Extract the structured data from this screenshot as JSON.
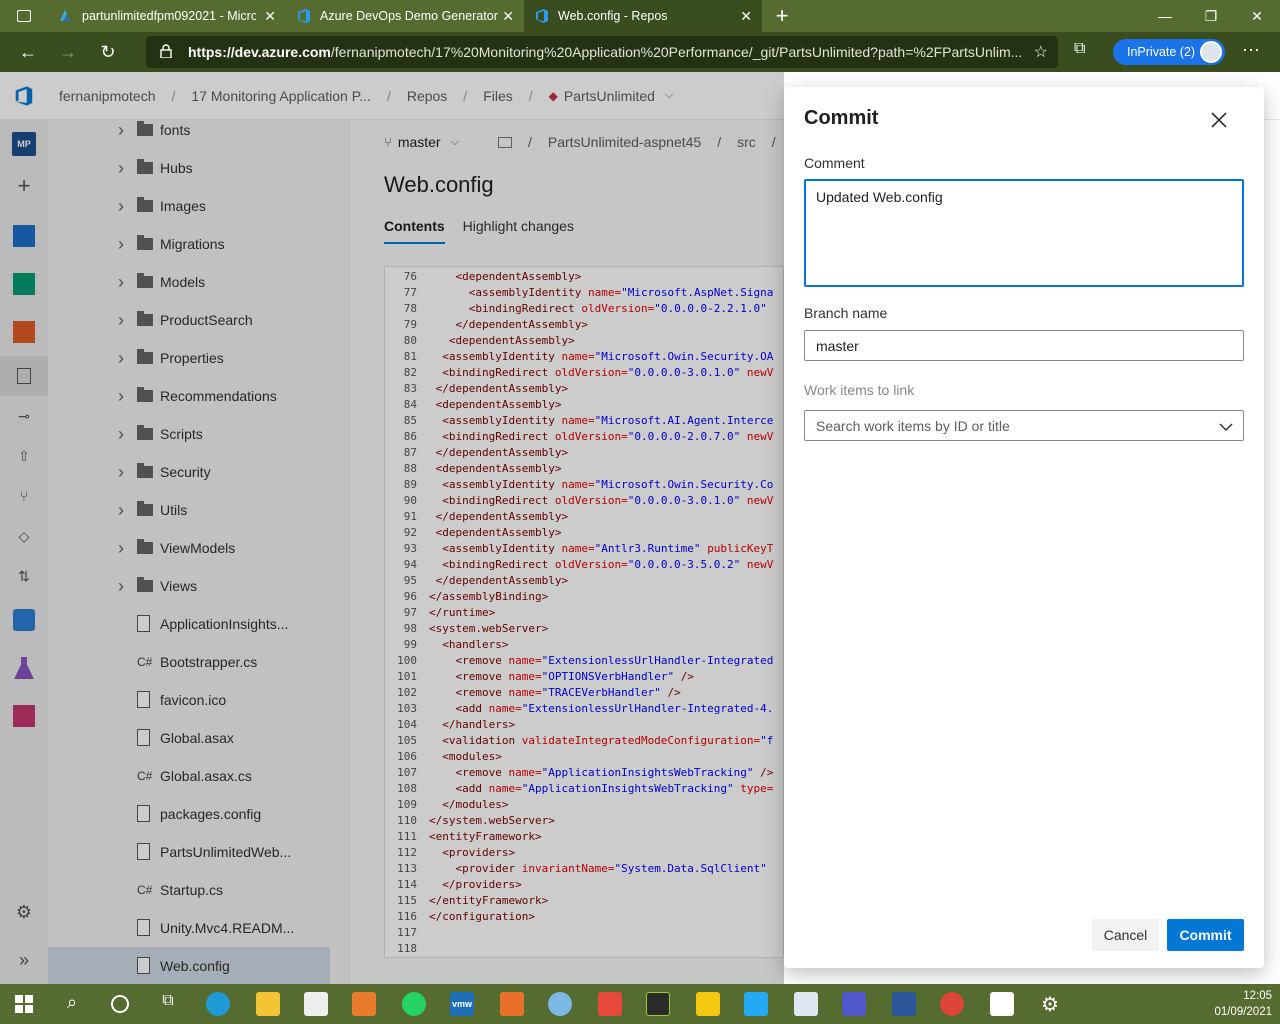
{
  "browser": {
    "tabs": [
      {
        "title": "partunlimitedfpm092021 - Micro",
        "active": false
      },
      {
        "title": "Azure DevOps Demo Generator",
        "active": false
      },
      {
        "title": "Web.config - Repos",
        "active": true
      }
    ],
    "url_host": "https://dev.azure.com",
    "url_path": "/fernanipmotech/17%20Monitoring%20Application%20Performance/_git/PartsUnlimited?path=%2FPartsUnlim...",
    "inprivate_label": "InPrivate (2)"
  },
  "header": {
    "breadcrumbs": [
      "fernanipmotech",
      "17 Monitoring Application P...",
      "Repos",
      "Files",
      "PartsUnlimited"
    ]
  },
  "rail": {
    "project_badge": "MP"
  },
  "tree": {
    "items": [
      {
        "label": "fonts",
        "kind": "folder"
      },
      {
        "label": "Hubs",
        "kind": "folder"
      },
      {
        "label": "Images",
        "kind": "folder"
      },
      {
        "label": "Migrations",
        "kind": "folder"
      },
      {
        "label": "Models",
        "kind": "folder"
      },
      {
        "label": "ProductSearch",
        "kind": "folder"
      },
      {
        "label": "Properties",
        "kind": "folder"
      },
      {
        "label": "Recommendations",
        "kind": "folder"
      },
      {
        "label": "Scripts",
        "kind": "folder"
      },
      {
        "label": "Security",
        "kind": "folder"
      },
      {
        "label": "Utils",
        "kind": "folder"
      },
      {
        "label": "ViewModels",
        "kind": "folder"
      },
      {
        "label": "Views",
        "kind": "folder"
      },
      {
        "label": "ApplicationInsights...",
        "kind": "file"
      },
      {
        "label": "Bootstrapper.cs",
        "kind": "cs"
      },
      {
        "label": "favicon.ico",
        "kind": "file"
      },
      {
        "label": "Global.asax",
        "kind": "file"
      },
      {
        "label": "Global.asax.cs",
        "kind": "cs"
      },
      {
        "label": "packages.config",
        "kind": "file"
      },
      {
        "label": "PartsUnlimitedWeb...",
        "kind": "file"
      },
      {
        "label": "Startup.cs",
        "kind": "cs"
      },
      {
        "label": "Unity.Mvc4.READM...",
        "kind": "file"
      },
      {
        "label": "Web.config",
        "kind": "file",
        "selected": true
      }
    ],
    "cs_badge": "C#"
  },
  "main": {
    "branch": "master",
    "path": [
      "PartsUnlimited-aspnet45",
      "src"
    ],
    "file_title": "Web.config",
    "tabs": [
      "Contents",
      "Highlight changes"
    ],
    "code_lines": [
      {
        "n": "76",
        "segs": [
          [
            "    ",
            ""
          ],
          [
            "<dependentAssembly>",
            "tg"
          ]
        ]
      },
      {
        "n": "77",
        "segs": [
          [
            "      ",
            ""
          ],
          [
            "<assemblyIdentity ",
            "tg"
          ],
          [
            "name=",
            "an"
          ],
          [
            "\"Microsoft.AspNet.Signa",
            "av"
          ]
        ]
      },
      {
        "n": "78",
        "segs": [
          [
            "      ",
            ""
          ],
          [
            "<bindingRedirect ",
            "tg"
          ],
          [
            "oldVersion=",
            "an"
          ],
          [
            "\"0.0.0.0-2.2.1.0\"",
            "av"
          ]
        ]
      },
      {
        "n": "79",
        "segs": [
          [
            "    ",
            ""
          ],
          [
            "</dependentAssembly>",
            "tg"
          ]
        ]
      },
      {
        "n": "80",
        "segs": [
          [
            "   ",
            ""
          ],
          [
            "<dependentAssembly>",
            "tg"
          ]
        ]
      },
      {
        "n": "81",
        "segs": [
          [
            "  ",
            ""
          ],
          [
            "<assemblyIdentity ",
            "tg"
          ],
          [
            "name=",
            "an"
          ],
          [
            "\"Microsoft.Owin.Security.OA",
            "av"
          ]
        ]
      },
      {
        "n": "82",
        "segs": [
          [
            "  ",
            ""
          ],
          [
            "<bindingRedirect ",
            "tg"
          ],
          [
            "oldVersion=",
            "an"
          ],
          [
            "\"0.0.0.0-3.0.1.0\" ",
            "av"
          ],
          [
            "newV",
            "an"
          ]
        ]
      },
      {
        "n": "83",
        "segs": [
          [
            " ",
            ""
          ],
          [
            "</dependentAssembly>",
            "tg"
          ]
        ]
      },
      {
        "n": "84",
        "segs": [
          [
            " ",
            ""
          ],
          [
            "<dependentAssembly>",
            "tg"
          ]
        ]
      },
      {
        "n": "85",
        "segs": [
          [
            "  ",
            ""
          ],
          [
            "<assemblyIdentity ",
            "tg"
          ],
          [
            "name=",
            "an"
          ],
          [
            "\"Microsoft.AI.Agent.Interce",
            "av"
          ]
        ]
      },
      {
        "n": "86",
        "segs": [
          [
            "  ",
            ""
          ],
          [
            "<bindingRedirect ",
            "tg"
          ],
          [
            "oldVersion=",
            "an"
          ],
          [
            "\"0.0.0.0-2.0.7.0\" ",
            "av"
          ],
          [
            "newV",
            "an"
          ]
        ]
      },
      {
        "n": "87",
        "segs": [
          [
            " ",
            ""
          ],
          [
            "</dependentAssembly>",
            "tg"
          ]
        ]
      },
      {
        "n": "88",
        "segs": [
          [
            " ",
            ""
          ],
          [
            "<dependentAssembly>",
            "tg"
          ]
        ]
      },
      {
        "n": "89",
        "segs": [
          [
            "  ",
            ""
          ],
          [
            "<assemblyIdentity ",
            "tg"
          ],
          [
            "name=",
            "an"
          ],
          [
            "\"Microsoft.Owin.Security.Co",
            "av"
          ]
        ]
      },
      {
        "n": "90",
        "segs": [
          [
            "  ",
            ""
          ],
          [
            "<bindingRedirect ",
            "tg"
          ],
          [
            "oldVersion=",
            "an"
          ],
          [
            "\"0.0.0.0-3.0.1.0\" ",
            "av"
          ],
          [
            "newV",
            "an"
          ]
        ]
      },
      {
        "n": "91",
        "segs": [
          [
            " ",
            ""
          ],
          [
            "</dependentAssembly>",
            "tg"
          ]
        ]
      },
      {
        "n": "92",
        "segs": [
          [
            " ",
            ""
          ],
          [
            "<dependentAssembly>",
            "tg"
          ]
        ]
      },
      {
        "n": "93",
        "segs": [
          [
            "  ",
            ""
          ],
          [
            "<assemblyIdentity ",
            "tg"
          ],
          [
            "name=",
            "an"
          ],
          [
            "\"Antlr3.Runtime\" ",
            "av"
          ],
          [
            "publicKeyT",
            "an"
          ]
        ]
      },
      {
        "n": "94",
        "segs": [
          [
            "  ",
            ""
          ],
          [
            "<bindingRedirect ",
            "tg"
          ],
          [
            "oldVersion=",
            "an"
          ],
          [
            "\"0.0.0.0-3.5.0.2\" ",
            "av"
          ],
          [
            "newV",
            "an"
          ]
        ]
      },
      {
        "n": "95",
        "segs": [
          [
            " ",
            ""
          ],
          [
            "</dependentAssembly>",
            "tg"
          ]
        ]
      },
      {
        "n": "96",
        "segs": [
          [
            "",
            ""
          ],
          [
            "</assemblyBinding>",
            "tg"
          ]
        ]
      },
      {
        "n": "97",
        "segs": [
          [
            "",
            ""
          ],
          [
            "</runtime>",
            "tg"
          ]
        ]
      },
      {
        "n": "98",
        "segs": [
          [
            "",
            ""
          ],
          [
            "<system.webServer>",
            "tg"
          ]
        ]
      },
      {
        "n": "99",
        "segs": [
          [
            "  ",
            ""
          ],
          [
            "<handlers>",
            "tg"
          ]
        ]
      },
      {
        "n": "100",
        "segs": [
          [
            "    ",
            ""
          ],
          [
            "<remove ",
            "tg"
          ],
          [
            "name=",
            "an"
          ],
          [
            "\"ExtensionlessUrlHandler-Integrated",
            "av"
          ]
        ]
      },
      {
        "n": "101",
        "segs": [
          [
            "    ",
            ""
          ],
          [
            "<remove ",
            "tg"
          ],
          [
            "name=",
            "an"
          ],
          [
            "\"OPTIONSVerbHandler\" ",
            "av"
          ],
          [
            "/>",
            "tg"
          ]
        ]
      },
      {
        "n": "102",
        "segs": [
          [
            "    ",
            ""
          ],
          [
            "<remove ",
            "tg"
          ],
          [
            "name=",
            "an"
          ],
          [
            "\"TRACEVerbHandler\" ",
            "av"
          ],
          [
            "/>",
            "tg"
          ]
        ]
      },
      {
        "n": "103",
        "segs": [
          [
            "    ",
            ""
          ],
          [
            "<add ",
            "tg"
          ],
          [
            "name=",
            "an"
          ],
          [
            "\"ExtensionlessUrlHandler-Integrated-4.",
            "av"
          ]
        ]
      },
      {
        "n": "104",
        "segs": [
          [
            "  ",
            ""
          ],
          [
            "</handlers>",
            "tg"
          ]
        ]
      },
      {
        "n": "105",
        "segs": [
          [
            "  ",
            ""
          ],
          [
            "<validation ",
            "tg"
          ],
          [
            "validateIntegratedModeConfiguration=",
            "an"
          ],
          [
            "\"f",
            "av"
          ]
        ]
      },
      {
        "n": "106",
        "segs": [
          [
            "  ",
            ""
          ],
          [
            "<modules>",
            "tg"
          ]
        ]
      },
      {
        "n": "107",
        "segs": [
          [
            "    ",
            ""
          ],
          [
            "<remove ",
            "tg"
          ],
          [
            "name=",
            "an"
          ],
          [
            "\"ApplicationInsightsWebTracking\" ",
            "av"
          ],
          [
            "/>",
            "tg"
          ]
        ]
      },
      {
        "n": "108",
        "segs": [
          [
            "    ",
            ""
          ],
          [
            "<add ",
            "tg"
          ],
          [
            "name=",
            "an"
          ],
          [
            "\"ApplicationInsightsWebTracking\" ",
            "av"
          ],
          [
            "type=",
            "an"
          ]
        ]
      },
      {
        "n": "109",
        "segs": [
          [
            "  ",
            ""
          ],
          [
            "</modules>",
            "tg"
          ]
        ]
      },
      {
        "n": "110",
        "segs": [
          [
            "",
            ""
          ],
          [
            "</system.webServer>",
            "tg"
          ]
        ]
      },
      {
        "n": "111",
        "segs": [
          [
            "",
            ""
          ],
          [
            "<entityFramework>",
            "tg"
          ]
        ]
      },
      {
        "n": "112",
        "segs": [
          [
            "  ",
            ""
          ],
          [
            "<providers>",
            "tg"
          ]
        ]
      },
      {
        "n": "113",
        "segs": [
          [
            "    ",
            ""
          ],
          [
            "<provider ",
            "tg"
          ],
          [
            "invariantName=",
            "an"
          ],
          [
            "\"System.Data.SqlClient\"",
            "av"
          ]
        ]
      },
      {
        "n": "114",
        "segs": [
          [
            "  ",
            ""
          ],
          [
            "</providers>",
            "tg"
          ]
        ]
      },
      {
        "n": "115",
        "segs": [
          [
            "",
            ""
          ],
          [
            "</entityFramework>",
            "tg"
          ]
        ]
      },
      {
        "n": "116",
        "segs": [
          [
            "",
            ""
          ],
          [
            "</configuration>",
            "tg"
          ]
        ]
      },
      {
        "n": "117",
        "segs": [
          [
            "",
            ""
          ]
        ]
      },
      {
        "n": "118",
        "segs": [
          [
            "",
            ""
          ]
        ]
      }
    ]
  },
  "commit_panel": {
    "title": "Commit",
    "comment_label": "Comment",
    "comment_value": "Updated Web.config",
    "branch_label": "Branch name",
    "branch_value": "master",
    "work_items_label": "Work items to link",
    "work_items_placeholder": "Search work items by ID or title",
    "cancel_label": "Cancel",
    "commit_label": "Commit"
  },
  "taskbar": {
    "time": "12:05",
    "date": "01/09/2021",
    "vmw_label": "vmw"
  },
  "colors": {
    "accent": "#0078d4",
    "browser_chrome": "#556b2f"
  }
}
